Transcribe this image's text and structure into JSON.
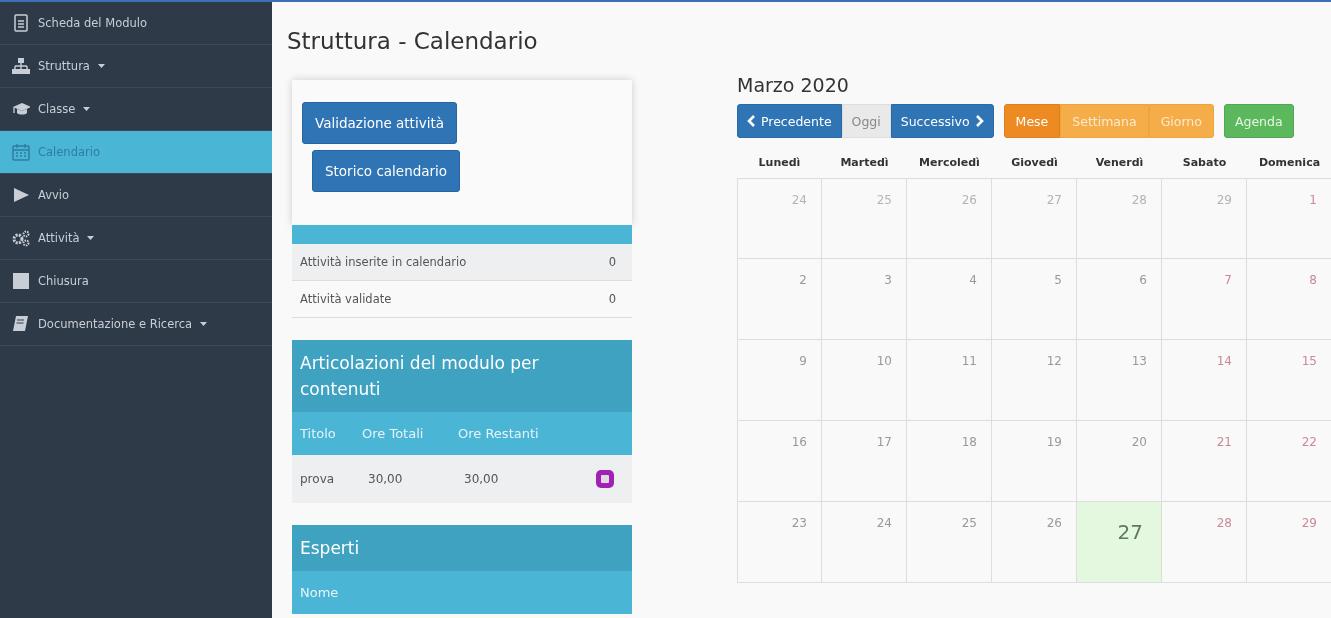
{
  "sidebar": {
    "items": [
      {
        "label": "Scheda del Modulo",
        "dropdown": false,
        "selected": false
      },
      {
        "label": "Struttura",
        "dropdown": true,
        "selected": false
      },
      {
        "label": "Classe",
        "dropdown": true,
        "selected": false
      },
      {
        "label": "Calendario",
        "dropdown": false,
        "selected": true
      },
      {
        "label": "Avvio",
        "dropdown": false,
        "selected": false
      },
      {
        "label": "Attività",
        "dropdown": true,
        "selected": false
      },
      {
        "label": "Chiusura",
        "dropdown": false,
        "selected": false
      },
      {
        "label": "Documentazione e Ricerca",
        "dropdown": true,
        "selected": false
      }
    ]
  },
  "page": {
    "title": "Struttura - Calendario"
  },
  "actions": [
    "Validazione attività",
    "Storico calendario"
  ],
  "summary": [
    {
      "label": "Attività inserite in calendario",
      "value": "0"
    },
    {
      "label": "Attività validate",
      "value": "0"
    }
  ],
  "articolazioni": {
    "title": "Articolazioni del modulo per contenuti",
    "columns": [
      "Titolo",
      "Ore Totali",
      "Ore Restanti"
    ],
    "rows": [
      {
        "titolo": "prova",
        "ore_totali": "30,00",
        "ore_restanti": "30,00"
      }
    ]
  },
  "esperti": {
    "title": "Esperti",
    "columns": [
      "Nome"
    ]
  },
  "calendar": {
    "month": "Marzo 2020",
    "nav": [
      {
        "kind": "prev",
        "label": "Precedente",
        "disabled": false
      },
      {
        "kind": "today",
        "label": "Oggi",
        "disabled": true
      },
      {
        "kind": "next",
        "label": "Successivo",
        "disabled": false
      }
    ],
    "views": [
      {
        "label": "Mese",
        "selected": true
      },
      {
        "label": "Settimana",
        "selected": false
      },
      {
        "label": "Giorno",
        "selected": false
      },
      {
        "label": "Agenda",
        "selected": false,
        "kind": "agenda"
      }
    ],
    "weekdays": [
      "Lunedì",
      "Martedì",
      "Mercoledì",
      "Giovedì",
      "Venerdì",
      "Sabato",
      "Domenica"
    ],
    "weeks": [
      [
        {
          "day": "24",
          "kind": "other"
        },
        {
          "day": "25",
          "kind": "other"
        },
        {
          "day": "26",
          "kind": "other"
        },
        {
          "day": "27",
          "kind": "other"
        },
        {
          "day": "28",
          "kind": "other"
        },
        {
          "day": "29",
          "kind": "other"
        },
        {
          "day": "1",
          "kind": "weekend"
        }
      ],
      [
        {
          "day": "2",
          "kind": "day"
        },
        {
          "day": "3",
          "kind": "day"
        },
        {
          "day": "4",
          "kind": "day"
        },
        {
          "day": "5",
          "kind": "day"
        },
        {
          "day": "6",
          "kind": "day"
        },
        {
          "day": "7",
          "kind": "weekend"
        },
        {
          "day": "8",
          "kind": "weekend"
        }
      ],
      [
        {
          "day": "9",
          "kind": "day"
        },
        {
          "day": "10",
          "kind": "day"
        },
        {
          "day": "11",
          "kind": "day"
        },
        {
          "day": "12",
          "kind": "day"
        },
        {
          "day": "13",
          "kind": "day"
        },
        {
          "day": "14",
          "kind": "weekend"
        },
        {
          "day": "15",
          "kind": "weekend"
        }
      ],
      [
        {
          "day": "16",
          "kind": "day"
        },
        {
          "day": "17",
          "kind": "day"
        },
        {
          "day": "18",
          "kind": "day"
        },
        {
          "day": "19",
          "kind": "day"
        },
        {
          "day": "20",
          "kind": "day"
        },
        {
          "day": "21",
          "kind": "weekend"
        },
        {
          "day": "22",
          "kind": "weekend"
        }
      ],
      [
        {
          "day": "23",
          "kind": "day"
        },
        {
          "day": "24",
          "kind": "day"
        },
        {
          "day": "25",
          "kind": "day"
        },
        {
          "day": "26",
          "kind": "day"
        },
        {
          "day": "27",
          "kind": "today"
        },
        {
          "day": "28",
          "kind": "weekend"
        },
        {
          "day": "29",
          "kind": "weekend"
        }
      ]
    ]
  }
}
